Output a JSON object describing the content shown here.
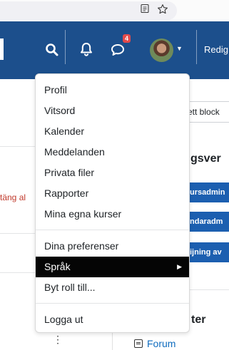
{
  "navbar": {
    "notification_badge": "4",
    "edit_text": "Redig"
  },
  "page": {
    "add_block": "ett block",
    "section_heading_1": "gsver",
    "btn_1": "ursadmin",
    "btn_2": "ndaradm",
    "btn_3": "ijning av",
    "red_text": "täng al",
    "section_heading_2": "ter",
    "forum_link": "Forum",
    "kebab": "⋮"
  },
  "user_menu": {
    "items": [
      {
        "label": "Profil"
      },
      {
        "label": "Vitsord"
      },
      {
        "label": "Kalender"
      },
      {
        "label": "Meddelanden"
      },
      {
        "label": "Privata filer"
      },
      {
        "label": "Rapporter"
      },
      {
        "label": "Mina egna kurser"
      }
    ],
    "preferences": "Dina preferenser",
    "language": "Språk",
    "switch_role": "Byt roll till...",
    "logout": "Logga ut"
  },
  "colors": {
    "navbar": "#1c4f8c",
    "active_item": "#050505",
    "badge": "#e34a4a",
    "link": "#0f6cbf"
  },
  "icons": [
    "reader-view-icon",
    "bookmark-star-icon",
    "search-icon",
    "bell-icon",
    "chat-icon",
    "user-avatar",
    "chevron-down-icon",
    "chevron-right-icon",
    "forum-icon"
  ]
}
